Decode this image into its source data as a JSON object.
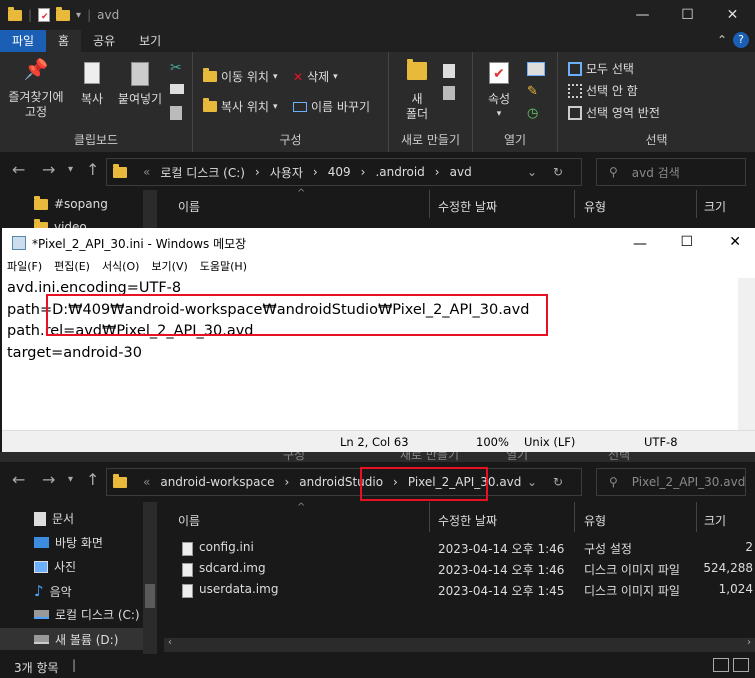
{
  "explorer_top": {
    "title": "avd",
    "tabs": [
      "파일",
      "홈",
      "공유",
      "보기"
    ],
    "ribbon": {
      "clipboard": {
        "pin": "즐겨찾기에\n고정",
        "copy": "복사",
        "paste": "붙여넣기",
        "label": "클립보드"
      },
      "organize": {
        "move_to": "이동 위치",
        "copy_to": "복사 위치",
        "delete": "삭제",
        "rename": "이름 바꾸기",
        "label": "구성"
      },
      "new": {
        "new_folder": "새\n폴더",
        "label": "새로 만들기"
      },
      "open": {
        "properties": "속성",
        "label": "열기"
      },
      "select": {
        "select_all": "모두 선택",
        "select_none": "선택 안 함",
        "invert": "선택 영역 반전",
        "label": "선택"
      }
    },
    "address": [
      "«",
      "로컬 디스크 (C:)",
      "›",
      "사용자",
      "›",
      "409",
      "›",
      ".android",
      "›",
      "avd"
    ],
    "search_placeholder": "avd 검색",
    "columns": {
      "name": "이름",
      "modified": "수정한 날짜",
      "type": "유형",
      "size": "크기"
    },
    "sidebar": [
      "#sopang",
      "video"
    ]
  },
  "notepad": {
    "title": "*Pixel_2_API_30.ini - Windows 메모장",
    "menu": [
      "파일(F)",
      "편집(E)",
      "서식(O)",
      "보기(V)",
      "도움말(H)"
    ],
    "lines": [
      "avd.ini.encoding=UTF-8",
      "path=D:₩409₩android-workspace₩androidStudio₩Pixel_2_API_30.avd",
      "path.rel=avd₩Pixel_2_API_30.avd",
      "target=android-30"
    ],
    "status": {
      "position": "Ln 2, Col 63",
      "zoom": "100%",
      "line_ending": "Unix (LF)",
      "encoding": "UTF-8"
    }
  },
  "explorer_bottom": {
    "ghost_labels": [
      "구성",
      "새로 만들기",
      "열기",
      "선택"
    ],
    "address": [
      "«",
      "android-workspace",
      "›",
      "androidStudio",
      "›",
      "Pixel_2_API_30.avd"
    ],
    "search_placeholder": "Pixel_2_API_30.avd",
    "columns": {
      "name": "이름",
      "modified": "수정한 날짜",
      "type": "유형",
      "size": "크기"
    },
    "sidebar": [
      {
        "icon": "document-icon",
        "label": "문서"
      },
      {
        "icon": "desktop-icon",
        "label": "바탕 화면"
      },
      {
        "icon": "pictures-icon",
        "label": "사진"
      },
      {
        "icon": "music-icon",
        "label": "음악"
      },
      {
        "icon": "drive-icon",
        "label": "로컬 디스크 (C:)"
      },
      {
        "icon": "drive-icon",
        "label": "새 볼륨 (D:)"
      }
    ],
    "files": [
      {
        "name": "config.ini",
        "modified": "2023-04-14 오후 1:46",
        "type": "구성 설정",
        "size": "2"
      },
      {
        "name": "sdcard.img",
        "modified": "2023-04-14 오후 1:46",
        "type": "디스크 이미지 파일",
        "size": "524,288"
      },
      {
        "name": "userdata.img",
        "modified": "2023-04-14 오후 1:45",
        "type": "디스크 이미지 파일",
        "size": "1,024"
      }
    ],
    "status": "3개 항목"
  },
  "colors": {
    "accent": "#1a5fb4",
    "highlight": "#e81123",
    "folder": "#e8b93a"
  }
}
